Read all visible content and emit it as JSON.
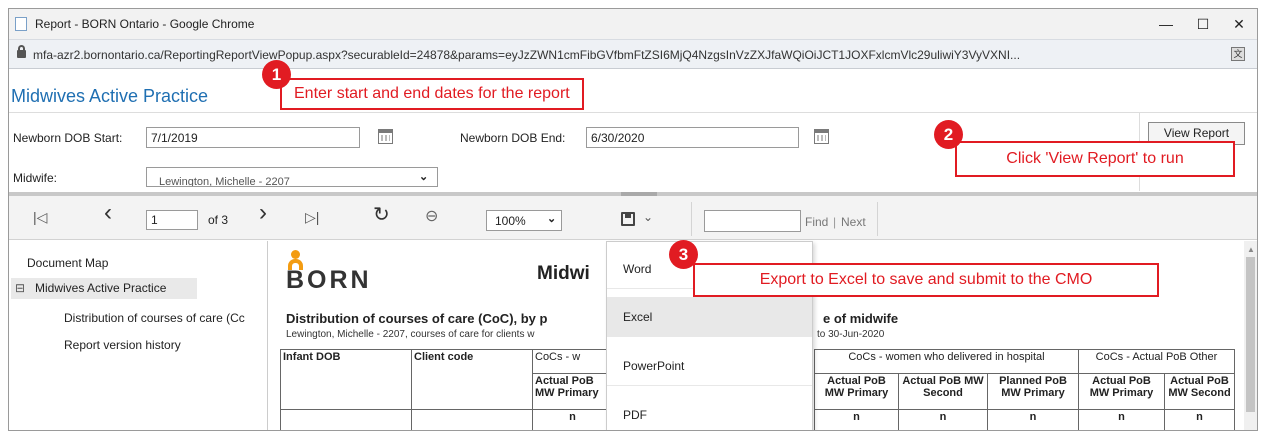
{
  "window": {
    "title": "Report - BORN Ontario - Google Chrome",
    "minimize": "—",
    "maximize": "☐",
    "close": "✕"
  },
  "address": {
    "url": "mfa-azr2.bornontario.ca/ReportingReportViewPopup.aspx?securableId=24878&params=eyJzZWN1cmFibGVfbmFtZSI6MjQ4NzgsInVzZXJfaWQiOiJCT1JOXFxlcmVlc29uliwiY3VyVXNI..."
  },
  "page": {
    "title": "Midwives Active Practice"
  },
  "params": {
    "dob_start_label": "Newborn DOB Start:",
    "dob_start_value": "7/1/2019",
    "dob_end_label": "Newborn DOB End:",
    "dob_end_value": "6/30/2020",
    "midwife_label": "Midwife:",
    "midwife_value": "Lewington, Michelle - 2207",
    "view_report": "View Report"
  },
  "toolbar": {
    "first": "|◁",
    "prev": "‹",
    "page_value": "1",
    "of_pages": "of 3",
    "next": "›",
    "last": "▷|",
    "refresh": "↻",
    "back": "⊖",
    "zoom": "100%",
    "export_icon": "floppy-disk",
    "find_placeholder": "",
    "find": "Find",
    "sep": "|",
    "find_next": "Next"
  },
  "docmap": {
    "title": "Document Map",
    "collapse": "⊟",
    "items": [
      "Midwives Active Practice",
      "Distribution of courses of care (Cc",
      "Report version history"
    ]
  },
  "report": {
    "logo": "BORN",
    "heading": "Midwi",
    "subheading_left": "Distribution of courses of care (CoC), by p",
    "subheading_right": "e of midwife",
    "meta_left": "Lewington, Michelle - 2207, courses of care for clients w",
    "meta_right": "to 30-Jun-2020",
    "table": {
      "c0": "Infant DOB",
      "c1": "Client code",
      "g0": "CoCs - w",
      "g1": "CoCs - women who delivered in hospital",
      "g2": "CoCs - Actual PoB Other",
      "sub": [
        "Actual PoB MW Primary",
        "Actual PoB MW Primary",
        "Actual PoB MW Second",
        "Planned PoB MW Primary",
        "Actual PoB MW Primary",
        "Actual PoB MW Second"
      ],
      "n": "n"
    }
  },
  "export_menu": [
    "Word",
    "Excel",
    "PowerPoint",
    "PDF"
  ],
  "callouts": [
    {
      "num": "1",
      "text": "Enter start and end dates for the report"
    },
    {
      "num": "2",
      "text": "Click 'View Report' to run"
    },
    {
      "num": "3",
      "text": "Export to Excel to save and submit to the CMO"
    }
  ],
  "colors": {
    "accent_red": "#e11b22",
    "title_blue": "#1f6fb2",
    "logo_orange": "#f39c12"
  }
}
